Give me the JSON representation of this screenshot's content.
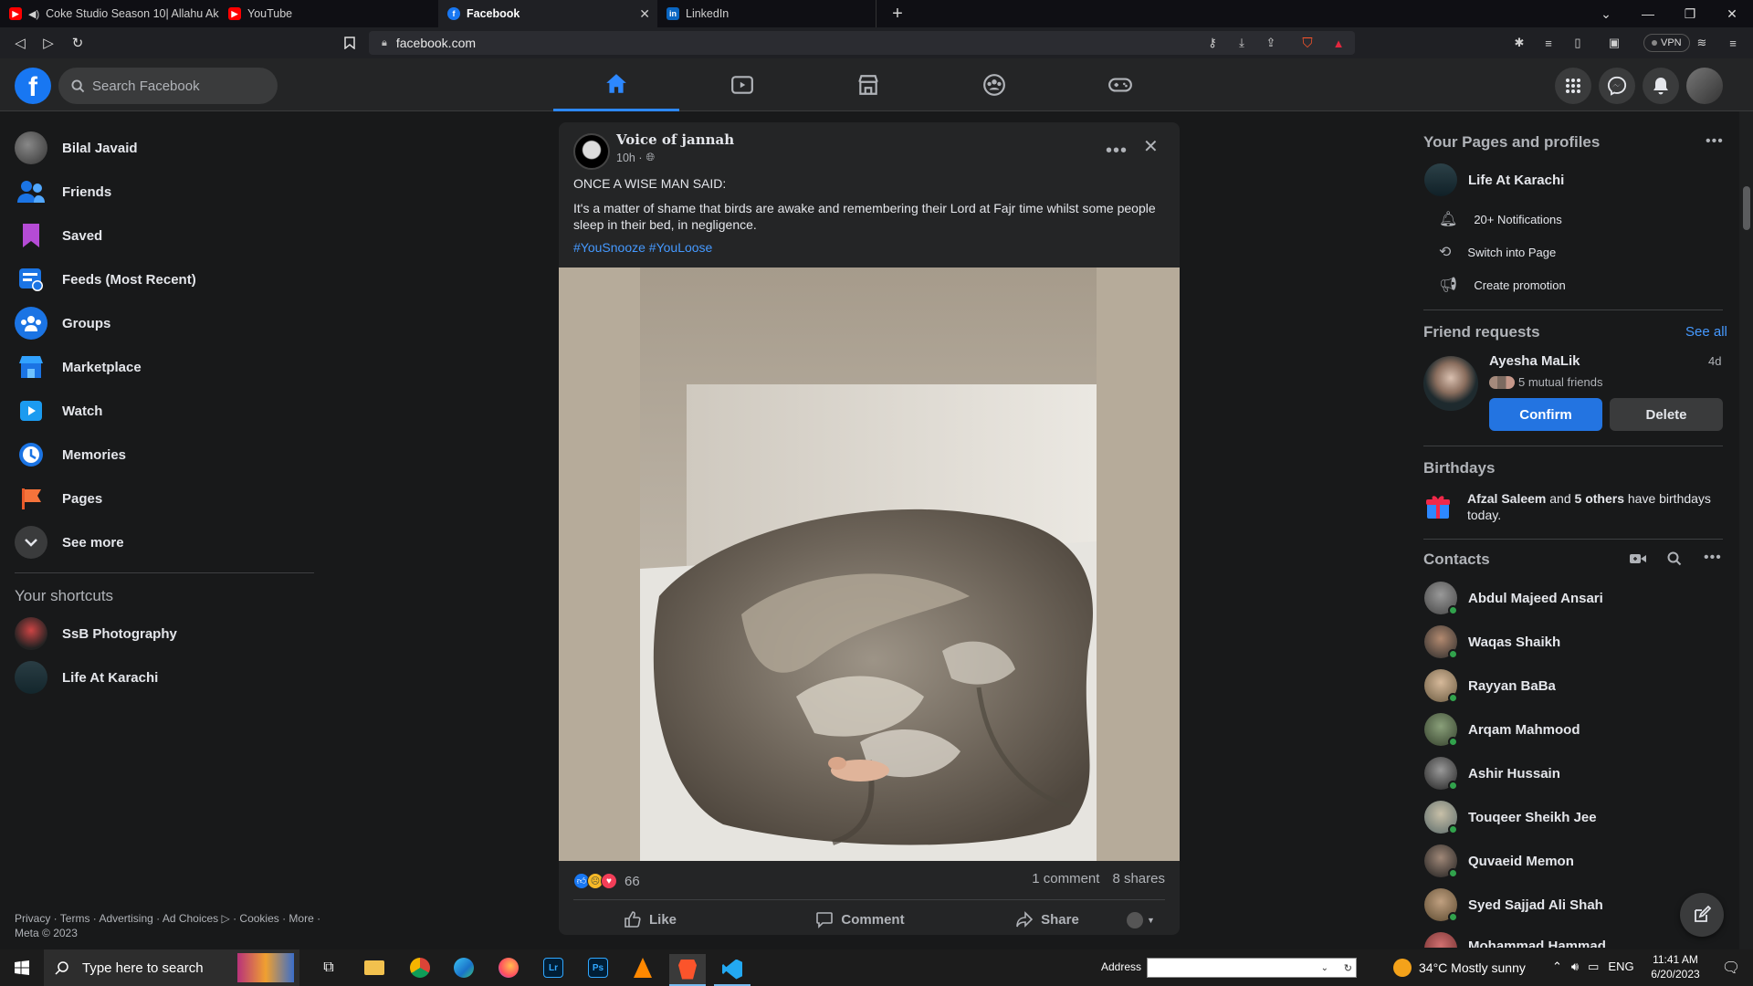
{
  "browser": {
    "tabs": [
      {
        "title": "Coke Studio Season 10| Allahu Ak..."
      },
      {
        "title": "YouTube"
      },
      {
        "title": "Facebook"
      },
      {
        "title": "LinkedIn"
      }
    ],
    "url": "facebook.com",
    "vpn_label": "VPN"
  },
  "header": {
    "search_placeholder": "Search Facebook"
  },
  "sidebar": {
    "items": [
      {
        "label": "Bilal Javaid",
        "icon": "profile-avatar"
      },
      {
        "label": "Friends",
        "icon": "friends-icon"
      },
      {
        "label": "Saved",
        "icon": "bookmark-icon"
      },
      {
        "label": "Feeds (Most Recent)",
        "icon": "feeds-icon"
      },
      {
        "label": "Groups",
        "icon": "groups-icon"
      },
      {
        "label": "Marketplace",
        "icon": "marketplace-icon"
      },
      {
        "label": "Watch",
        "icon": "watch-icon"
      },
      {
        "label": "Memories",
        "icon": "memories-icon"
      },
      {
        "label": "Pages",
        "icon": "pages-icon"
      },
      {
        "label": "See more",
        "icon": "chevron-down-icon"
      }
    ],
    "shortcuts_title": "Your shortcuts",
    "shortcuts": [
      {
        "label": "SsB Photography"
      },
      {
        "label": "Life At Karachi"
      }
    ],
    "footer_line1": "Privacy · Terms · Advertising · Ad Choices ▷ · Cookies · More ·",
    "footer_line2": "Meta © 2023"
  },
  "post": {
    "author": "Voice of jannah",
    "time": "10h ·",
    "line1": "ONCE A WISE MAN SAID:",
    "line2": "It's a matter of shame that birds are awake and remembering their Lord at Fajr time whilst some people sleep in their bed, in negligence.",
    "hashtags": "#YouSnooze #YouLoose",
    "reaction_count": "66",
    "comments": "1 comment",
    "shares": "8 shares",
    "like_label": "Like",
    "comment_label": "Comment",
    "share_label": "Share"
  },
  "right": {
    "pages_title": "Your Pages and profiles",
    "page_name": "Life At Karachi",
    "page_actions": [
      {
        "label": "20+ Notifications"
      },
      {
        "label": "Switch into Page"
      },
      {
        "label": "Create promotion"
      }
    ],
    "friend_requests_title": "Friend requests",
    "see_all": "See all",
    "request_name": "Ayesha MaLik",
    "request_time": "4d",
    "mutual": "5 mutual friends",
    "confirm": "Confirm",
    "delete": "Delete",
    "birthdays_title": "Birthdays",
    "birthday_name": "Afzal Saleem",
    "birthday_and": " and ",
    "birthday_others": "5 others",
    "birthday_rest": " have birthdays today.",
    "contacts_title": "Contacts",
    "contacts": [
      {
        "name": "Abdul Majeed Ansari"
      },
      {
        "name": "Waqas Shaikh"
      },
      {
        "name": "Rayyan BaBa"
      },
      {
        "name": "Arqam Mahmood"
      },
      {
        "name": "Ashir Hussain"
      },
      {
        "name": "Touqeer Sheikh Jee"
      },
      {
        "name": "Quvaeid Memon"
      },
      {
        "name": "Syed Sajjad Ali Shah"
      },
      {
        "name": "Mohammad Hammad"
      }
    ]
  },
  "taskbar": {
    "search_placeholder": "Type here to search",
    "address_label": "Address",
    "weather": "34°C  Mostly sunny",
    "lang": "ENG",
    "time": "11:41 AM",
    "date": "6/20/2023"
  },
  "colors": {
    "accent": "#1877f2",
    "background": "#18191a",
    "surface": "#242526"
  }
}
